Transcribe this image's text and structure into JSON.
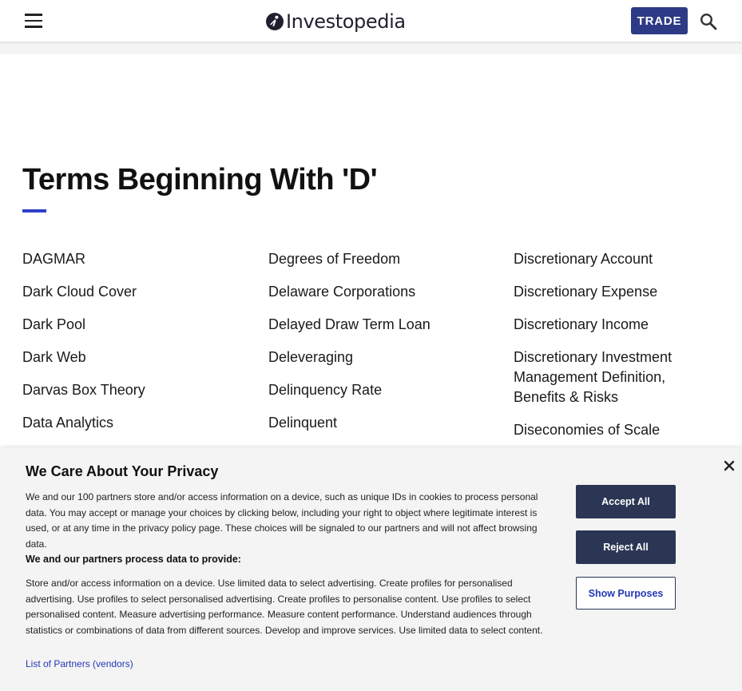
{
  "header": {
    "logo_text": "Investopedia",
    "trade_label": "TRADE",
    "icons": {
      "menu": "hamburger-menu-icon",
      "search": "search-icon",
      "logo": "investopedia-logo-icon"
    }
  },
  "main": {
    "title": "Terms Beginning With 'D'",
    "columns": [
      [
        "DAGMAR",
        "Dark Cloud Cover",
        "Dark Pool",
        "Dark Web",
        "Darvas Box Theory",
        "Data Analytics"
      ],
      [
        "Degrees of Freedom",
        "Delaware Corporations",
        "Delayed Draw Term Loan",
        "Deleveraging",
        "Delinquency Rate",
        "Delinquent"
      ],
      [
        "Discretionary Account",
        "Discretionary Expense",
        "Discretionary Income",
        "Discretionary Investment Management Definition, Benefits & Risks",
        "Diseconomies of Scale"
      ]
    ]
  },
  "privacy": {
    "title": "We Care About Your Privacy",
    "body": "We and our 100 partners store and/or access information on a device, such as unique IDs in cookies to process personal data. You may accept or manage your choices by clicking below, including your right to object where legitimate interest is used, or at any time in the privacy policy page. These choices will be signaled to our partners and will not affect browsing data.",
    "subheading": "We and our partners process data to provide:",
    "purposes": "Store and/or access information on a device. Use limited data to select advertising. Create profiles for personalised advertising. Use profiles to select personalised advertising. Create profiles to personalise content. Use profiles to select personalised content. Measure advertising performance. Measure content performance. Understand audiences through statistics or combinations of data from different sources. Develop and improve services. Use limited data to select content.",
    "partners_link": "List of Partners (vendors)",
    "accept_label": "Accept All",
    "reject_label": "Reject All",
    "show_purposes_label": "Show Purposes",
    "close_icon": "close-icon"
  },
  "colors": {
    "brand_navy": "#2d3a85",
    "accent_rule": "#2e40c8",
    "button_dark": "#2b3654",
    "link_blue": "#2637b8",
    "panel_bg": "#f4f4f4"
  }
}
